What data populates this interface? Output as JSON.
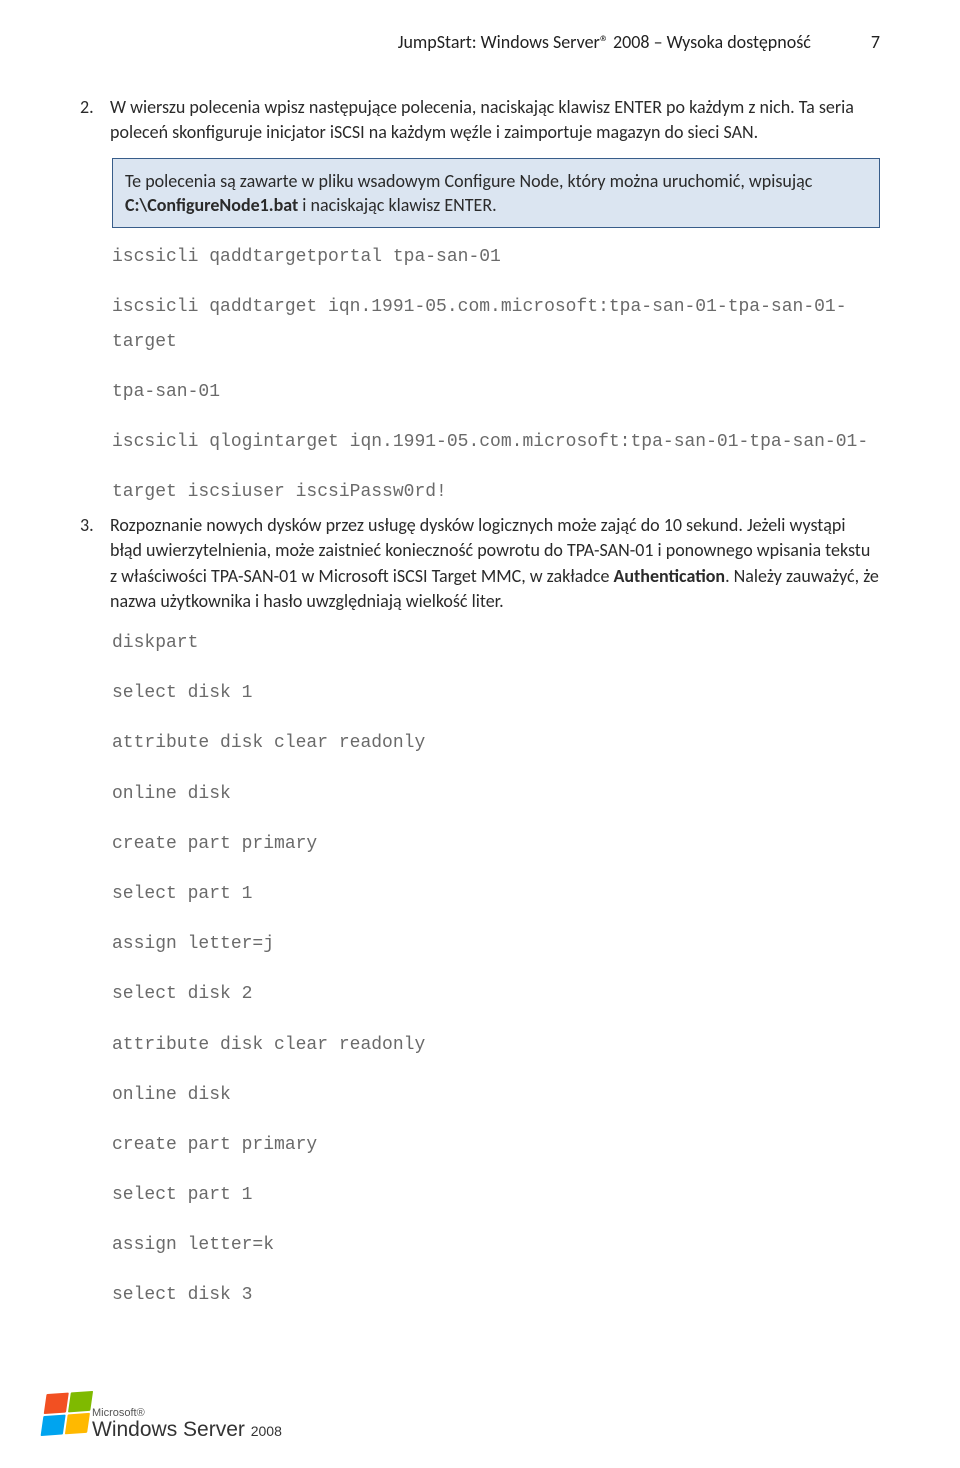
{
  "header": {
    "doc_title": "JumpStart: Windows Server® 2008 – Wysoka dostępność",
    "page_number": "7"
  },
  "items": [
    {
      "num": "2.",
      "para": "W wierszu polecenia wpisz następujące polecenia, naciskając klawisz ENTER po każdym z nich. Ta seria poleceń skonfiguruje inicjator iSCSI na każdym węźle i zaimportuje magazyn do sieci SAN.",
      "note_pre": "Te polecenia są zawarte w pliku wsadowym Configure Node, który można uruchomić, wpisując ",
      "note_path": "C:\\ConfigureNode1.bat",
      "note_post": " i naciskając klawisz ENTER.",
      "code": [
        "iscsicli qaddtargetportal tpa-san-01",
        "",
        "iscsicli qaddtarget iqn.1991-05.com.microsoft:tpa-san-01-tpa-san-01-target",
        "",
        "tpa-san-01",
        "",
        "iscsicli qlogintarget iqn.1991-05.com.microsoft:tpa-san-01-tpa-san-01-",
        "",
        "target iscsiuser iscsiPassw0rd!"
      ]
    },
    {
      "num": "3.",
      "para_pre": "Rozpoznanie nowych dysków przez usługę dysków logicznych może zająć do 10 sekund. Jeżeli wystąpi błąd uwierzytelnienia, może zaistnieć konieczność powrotu do TPA-SAN-01 i ponownego wpisania tekstu z właściwości TPA-SAN-01 w Microsoft iSCSI Target MMC, w zakładce ",
      "para_strong": "Authentication",
      "para_post": ". Należy zauważyć, że nazwa użytkownika i hasło uwzględniają wielkość liter.",
      "code": [
        "diskpart",
        "",
        "select disk 1",
        "",
        "attribute disk clear readonly",
        "",
        "online disk",
        "",
        "create part primary",
        "",
        "select part 1",
        "",
        "assign letter=j",
        "",
        "select disk 2",
        "",
        "attribute disk clear readonly",
        "",
        "online disk",
        "",
        "create part primary",
        "",
        "select part 1",
        "",
        "assign letter=k",
        "",
        "select disk 3"
      ]
    }
  ],
  "footer": {
    "ms": "Microsoft®",
    "ws": "Windows Server",
    "year": "2008"
  }
}
